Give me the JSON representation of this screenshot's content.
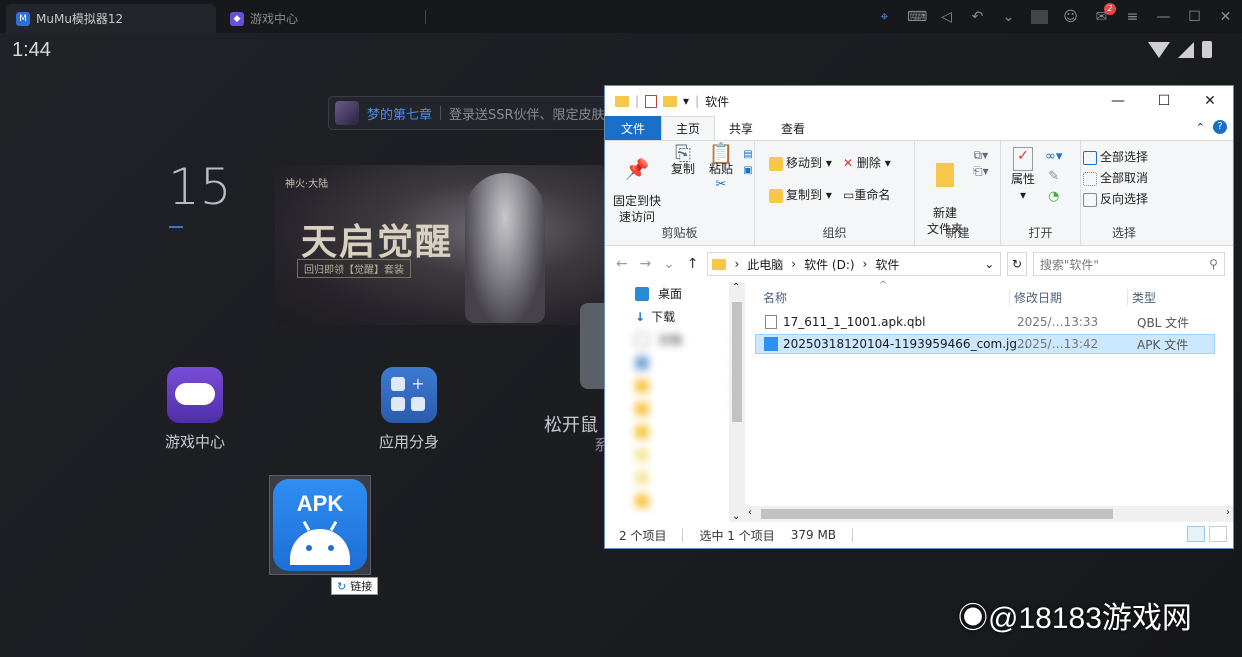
{
  "mumu": {
    "tab_active": "MuMu模拟器12",
    "tab_second": "游戏中心",
    "notification_count": "2"
  },
  "android": {
    "clock": "1:44",
    "ad": {
      "title": "梦的第七章",
      "text": "登录送SSR伙伴、限定皮肤"
    },
    "date_number": "15",
    "banner": {
      "subtitle": "神火·大陆",
      "title": "天启觉醒",
      "caption": "回归即领【觉醒】套装"
    },
    "apps": [
      {
        "label": "游戏中心",
        "icon": "gamepad-icon"
      },
      {
        "label": "应用分身",
        "icon": "app-clone-icon"
      }
    ],
    "release_text": "松开鼠",
    "release_sub": "系",
    "apk_icon_label": "APK",
    "link_tooltip": "链接"
  },
  "explorer": {
    "title": "软件",
    "tabs": [
      "文件",
      "主页",
      "共享",
      "查看"
    ],
    "ribbon": {
      "clipboard": {
        "pin": "固定到快\n速访问",
        "copy": "复制",
        "paste": "粘贴",
        "label": "剪贴板"
      },
      "organize": {
        "move_to": "移动到",
        "copy_to": "复制到",
        "delete": "删除",
        "rename": "重命名",
        "label": "组织"
      },
      "new": {
        "new_folder": "新建\n文件夹",
        "label": "新建"
      },
      "open": {
        "properties": "属性",
        "label": "打开"
      },
      "select": {
        "select_all": "全部选择",
        "select_none": "全部取消",
        "invert": "反向选择",
        "label": "选择"
      }
    },
    "address": {
      "parts": [
        "此电脑",
        "软件 (D:)",
        "软件"
      ],
      "search_placeholder": "搜索\"软件\""
    },
    "nav_items": [
      "桌面",
      "下载",
      "文档"
    ],
    "columns": {
      "name": "名称",
      "modified": "修改日期",
      "type": "类型"
    },
    "files": [
      {
        "name": "17_611_1_1001.apk.qbl",
        "date": "2025/…13:33",
        "type": "QBL 文件",
        "selected": false
      },
      {
        "name": "20250318120104-1193959466_com.jg...",
        "date": "2025/…13:42",
        "type": "APK 文件",
        "selected": true
      }
    ],
    "status": {
      "count": "2 个项目",
      "selected": "选中 1 个项目",
      "size": "379 MB"
    }
  },
  "watermark": "@18183游戏网",
  "colors": {
    "accent": "#1a6fc9",
    "selection": "#cce8ff",
    "apk_blue": "#2f8ef3"
  }
}
